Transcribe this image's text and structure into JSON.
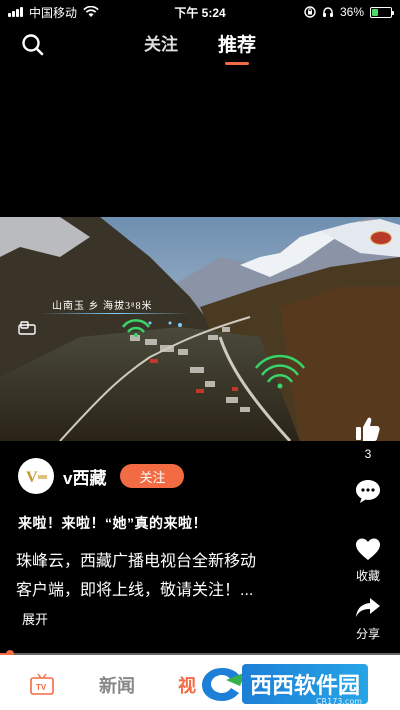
{
  "status_bar": {
    "carrier": "中国移动",
    "time": "下午 5:24",
    "battery": "36%",
    "battery_level": 0.36
  },
  "top_nav": {
    "tabs": [
      {
        "label": "关注",
        "active": false
      },
      {
        "label": "推荐",
        "active": true
      }
    ],
    "search_icon": "search-icon"
  },
  "video": {
    "caption": "山南玉 乡 海拔3⁸8米",
    "pip_icon": "picture-in-picture-icon"
  },
  "author": {
    "name": "v西藏",
    "follow_label": "关注",
    "avatar_text": "V"
  },
  "post": {
    "title": "来啦！来啦！“她”真的来啦！",
    "description": "珠峰云，西藏广播电视台全新移动客户端，即将上线，敬请关注！...",
    "expand_label": "展开"
  },
  "actions": [
    {
      "icon": "thumbs-up-icon",
      "label": "3"
    },
    {
      "icon": "comment-icon",
      "label": ""
    },
    {
      "icon": "heart-icon",
      "label": "收藏"
    },
    {
      "icon": "share-icon",
      "label": "分享"
    }
  ],
  "progress": {
    "value": 0.02
  },
  "bottom_bar": {
    "tv_icon_text": "TV",
    "news_label": "新闻",
    "video_label": "视听"
  },
  "watermark": {
    "text": "西西软件园",
    "sub": "CR173.com"
  },
  "colors": {
    "accent": "#f36b42",
    "background": "#000000"
  }
}
